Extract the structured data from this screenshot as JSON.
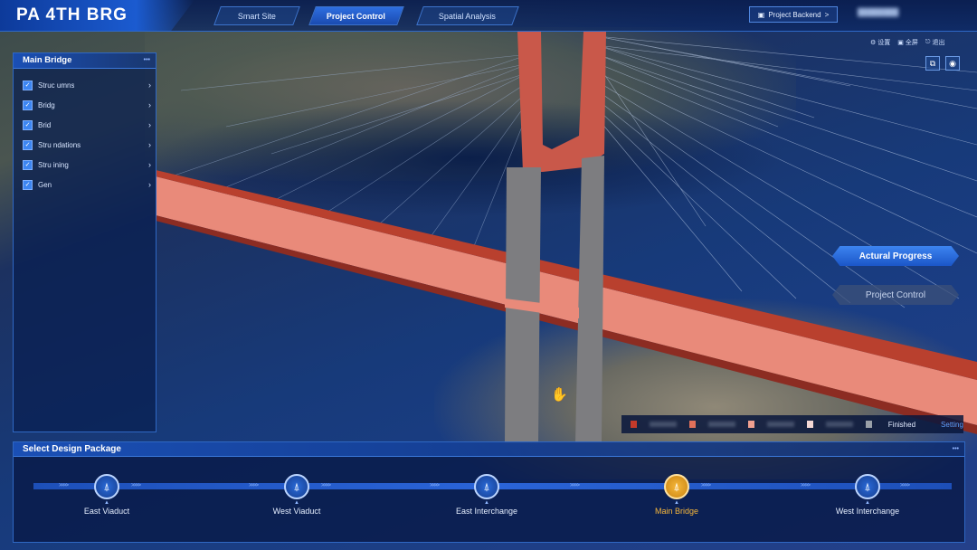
{
  "header": {
    "logo_text": "PA 4TH BRG",
    "tabs": [
      {
        "label": "Smart Site",
        "active": false
      },
      {
        "label": "Project Control",
        "active": true
      },
      {
        "label": "Spatial Analysis",
        "active": false
      }
    ],
    "backend_label": "Project Backend",
    "backend_chevron": ">"
  },
  "tools": {
    "items": [
      "设置",
      "全屏",
      "退出"
    ]
  },
  "left_panel": {
    "title": "Main Bridge",
    "items": [
      {
        "label": "Struc          umns",
        "checked": true
      },
      {
        "label": "Bridg",
        "checked": true
      },
      {
        "label": "Brid",
        "checked": true
      },
      {
        "label": "Stru          ndations",
        "checked": true
      },
      {
        "label": "Stru          ining",
        "checked": true
      },
      {
        "label": "Gen",
        "checked": true
      }
    ]
  },
  "side_buttons": {
    "actural_progress": "Actural Progress",
    "project_control": "Project Control"
  },
  "legend": {
    "colors": [
      "#c43a2a",
      "#e0705a",
      "#f0a090",
      "#f4d8d4",
      "#9aa0a8"
    ],
    "finished_label": "Finished",
    "setting_label": "Setting"
  },
  "bottom_panel": {
    "title": "Select Design Package",
    "packages": [
      {
        "name": "East Viaduct",
        "active": false
      },
      {
        "name": "West Viaduct",
        "active": false
      },
      {
        "name": "East Interchange",
        "active": false
      },
      {
        "name": "Main Bridge",
        "active": true
      },
      {
        "name": "West Interchange",
        "active": false
      }
    ],
    "arrow_text": ">>>>"
  },
  "colors": {
    "accent": "#2e6ee0",
    "active_package": "#f7b73b",
    "bridge_deck": "#e98a7a",
    "tower": "#c9584a"
  }
}
